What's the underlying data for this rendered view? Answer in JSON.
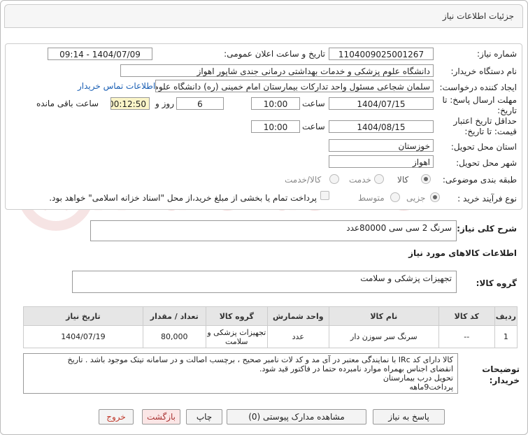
{
  "header": {
    "title": "جزئیات اطلاعات نیاز"
  },
  "form": {
    "need_number_label": "شماره نیاز:",
    "need_number": "1104009025001267",
    "announce_label": "تاریخ و ساعت اعلان عمومی:",
    "announce_value": "1404/07/09 - 09:14",
    "buyer_org_label": "نام دستگاه خریدار:",
    "buyer_org": "دانشگاه علوم پزشکی و خدمات بهداشتی درمانی جندی شاپور اهواز",
    "requester_label": "ایجاد کننده درخواست:",
    "requester": "سلمان شجاعی مسئول واحد تدارکات بیمارستان امام خمینی (ره) دانشگاه علوم",
    "contact_link": "اطلاعات تماس خریدار",
    "deadline_label": "مهلت ارسال پاسخ: تا تاریخ:",
    "deadline_date": "1404/07/15",
    "time_label": "ساعت",
    "deadline_time": "10:00",
    "days_value": "6",
    "days_label": "روز و",
    "remaining_time": "00:12:50",
    "remaining_label": "ساعت باقی مانده",
    "validity_label": "حداقل تاریخ اعتبار قیمت: تا تاریخ:",
    "validity_date": "1404/08/15",
    "validity_time": "10:00",
    "province_label": "استان محل تحویل:",
    "province": "خوزستان",
    "city_label": "شهر محل تحویل:",
    "city": "اهواز",
    "category_label": "طبقه بندی موضوعی:",
    "category_options": [
      "کالا",
      "خدمت",
      "کالا/خدمت"
    ],
    "process_label": "نوع فرآیند خرید :",
    "process_options": [
      "جزیی",
      "متوسط"
    ],
    "payment_note": "پرداخت تمام یا بخشی از مبلغ خرید،از محل \"اسناد خزانه اسلامی\" خواهد بود."
  },
  "summary": {
    "label": "شرح کلی نیاز:",
    "value": "سرنگ 2 سی سی   80000عدد"
  },
  "goods_info_title": "اطلاعات کالاهای مورد نیاز",
  "goods_group": {
    "label": "گروه کالا:",
    "value": "تجهیزات پزشکی و سلامت"
  },
  "table": {
    "headers": [
      "ردیف",
      "کد کالا",
      "نام کالا",
      "واحد شمارش",
      "گروه کالا",
      "تعداد / مقدار",
      "تاریخ نیاز"
    ],
    "rows": [
      [
        "1",
        "--",
        "سرنگ سر سوزن دار",
        "عدد",
        "تجهیزات پزشکی و سلامت",
        "80,000",
        "1404/07/19"
      ]
    ]
  },
  "buyer_notes": {
    "label": "توضیحات خریدار:",
    "lines": [
      "کالا دارای کد IRc با نمایندگی معتبر در آی مد و کد لات نامبر صحیح ، برچسب اصالت و در سامانه تیتک موجود باشد . تاریخ",
      "انقضای اجناس بهمراه موارد نامبرده حتما در فاکتور قید شود.",
      "تحویل درب بیمارستان",
      "پرداخت9ماهه"
    ]
  },
  "buttons": {
    "reply": "پاسخ به نیاز",
    "attachments": "مشاهده مدارک پیوستی (0)",
    "print": "چاپ",
    "back": "بازگشت",
    "exit": "خروج"
  },
  "watermark": "AriaTender.net",
  "colors": {
    "link": "#1a5fb4",
    "timer_bg": "#fbf5c8",
    "exit_red": "#c0392b"
  }
}
